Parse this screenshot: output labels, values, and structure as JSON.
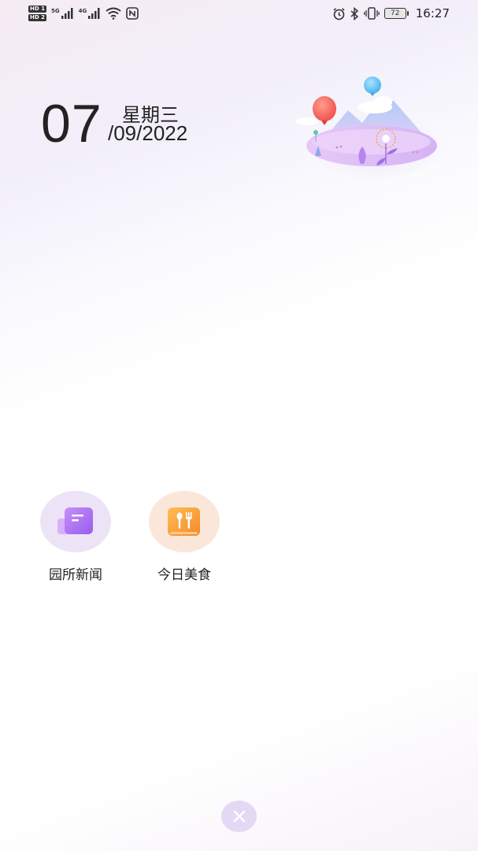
{
  "statusbar": {
    "sim1": "HD 1",
    "sim2": "HD 2",
    "net1": "5G",
    "net2": "4G",
    "battery": "72",
    "time": "16:27"
  },
  "date": {
    "day": "07",
    "weekday": "星期三",
    "month_year": "/09/2022"
  },
  "apps": [
    {
      "label": "园所新闻",
      "icon": "news-icon",
      "color": "#b47cf0"
    },
    {
      "label": "今日美食",
      "icon": "food-icon",
      "color": "#f5a13a"
    }
  ],
  "colors": {
    "accent_purple": "#b47cf0",
    "accent_orange": "#f5a13a",
    "close_bg": "#e3d9f5"
  }
}
